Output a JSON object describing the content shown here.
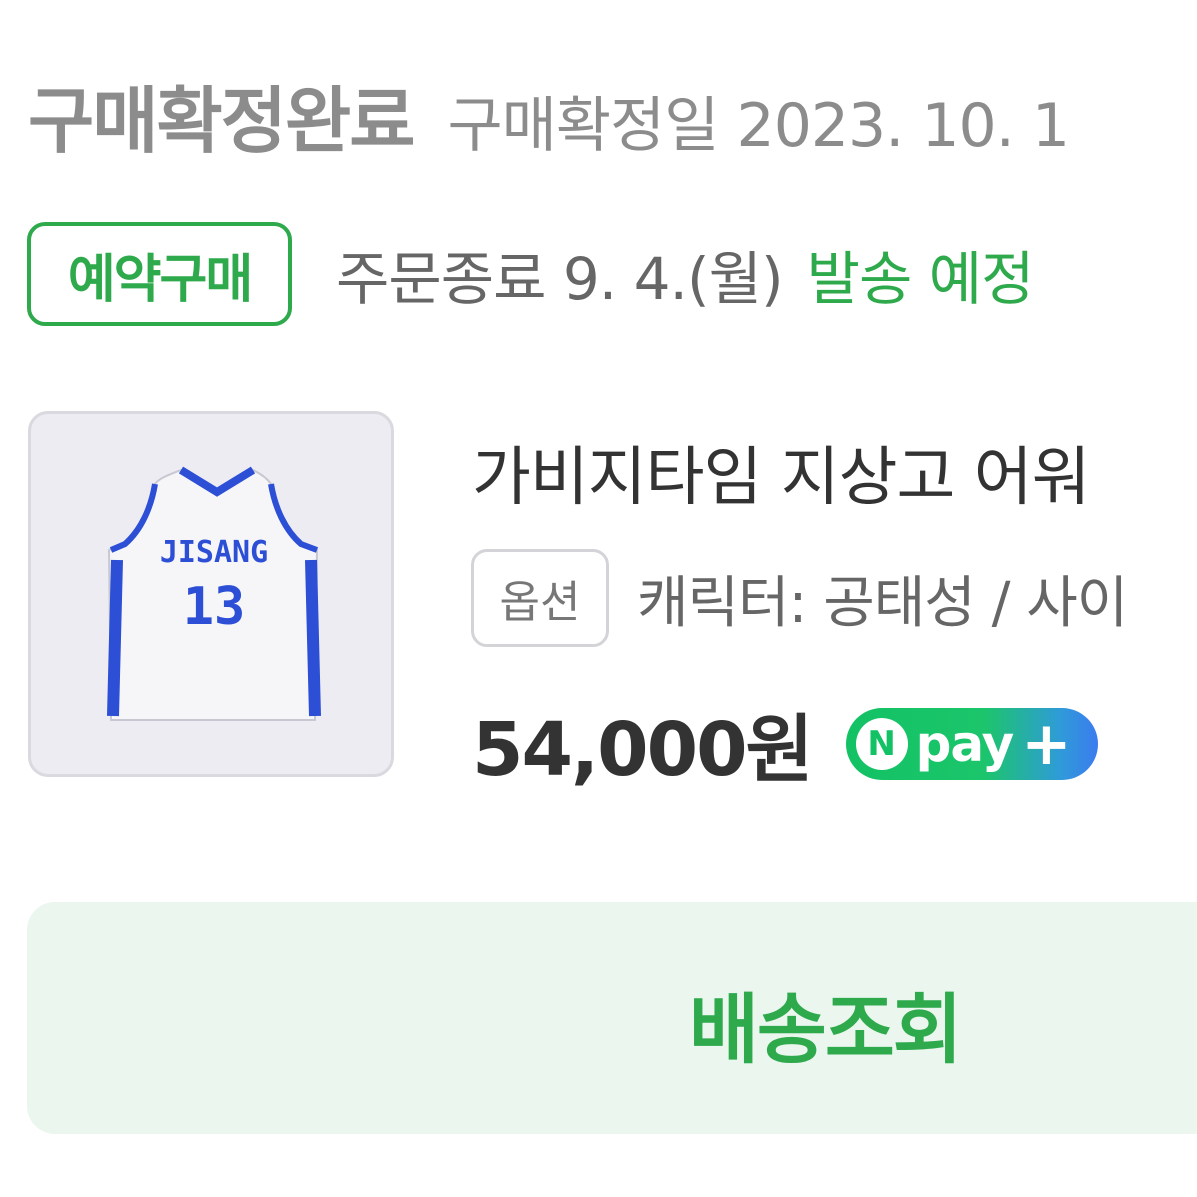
{
  "order_status": {
    "title": "구매확정완료",
    "confirm_date_text": "구매확정일 2023. 10. 1"
  },
  "preorder": {
    "badge_label": "예약구매",
    "order_end_text": "주문종료 9. 4.(월)",
    "ship_note_text": "발송 예정"
  },
  "product": {
    "name": "가비지타임 지상고 어워",
    "option_tag": "옵션",
    "option_text": "캐릭터: 공태성 / 사이",
    "price": "54,000원",
    "jersey_team_text": "JISANG",
    "jersey_number": "13"
  },
  "npay": {
    "icon_letter": "N",
    "label": "pay",
    "plus": "+"
  },
  "actions": {
    "track_delivery_label": "배송조회"
  },
  "colors": {
    "accent_green": "#2eaa4c",
    "muted_gray": "#8c8c8c",
    "jersey_blue": "#2c4fd6",
    "button_bg": "#eaf6ee"
  }
}
